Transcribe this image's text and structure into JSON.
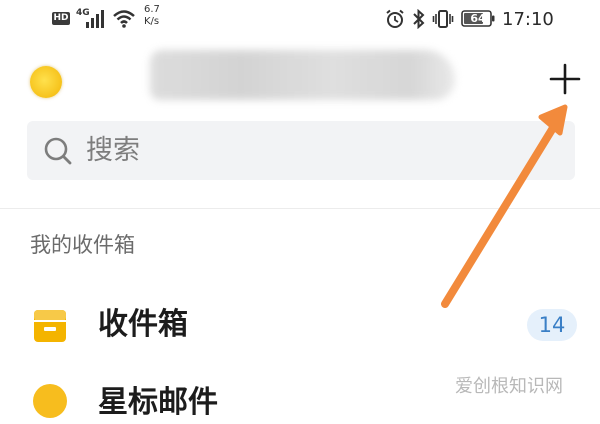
{
  "status_bar": {
    "hd": "HD",
    "network": "4G",
    "speed_top": "6.7",
    "speed_bottom": "K/s",
    "battery": "64",
    "time": "17:10"
  },
  "header": {
    "avatar_icon": "sun-avatar",
    "add_icon": "plus-icon"
  },
  "search": {
    "icon": "search-icon",
    "placeholder": "搜索"
  },
  "section": {
    "title": "我的收件箱"
  },
  "mail_items": [
    {
      "icon": "inbox-icon",
      "label": "收件箱",
      "count": "14"
    },
    {
      "icon": "star-icon",
      "label": "星标邮件"
    }
  ],
  "watermark": "爱创根知识网",
  "colors": {
    "accent": "#3a7fc6",
    "badge_bg": "#e5f0fb",
    "inbox_icon": "#f4b400",
    "arrow": "#f28a3c"
  }
}
